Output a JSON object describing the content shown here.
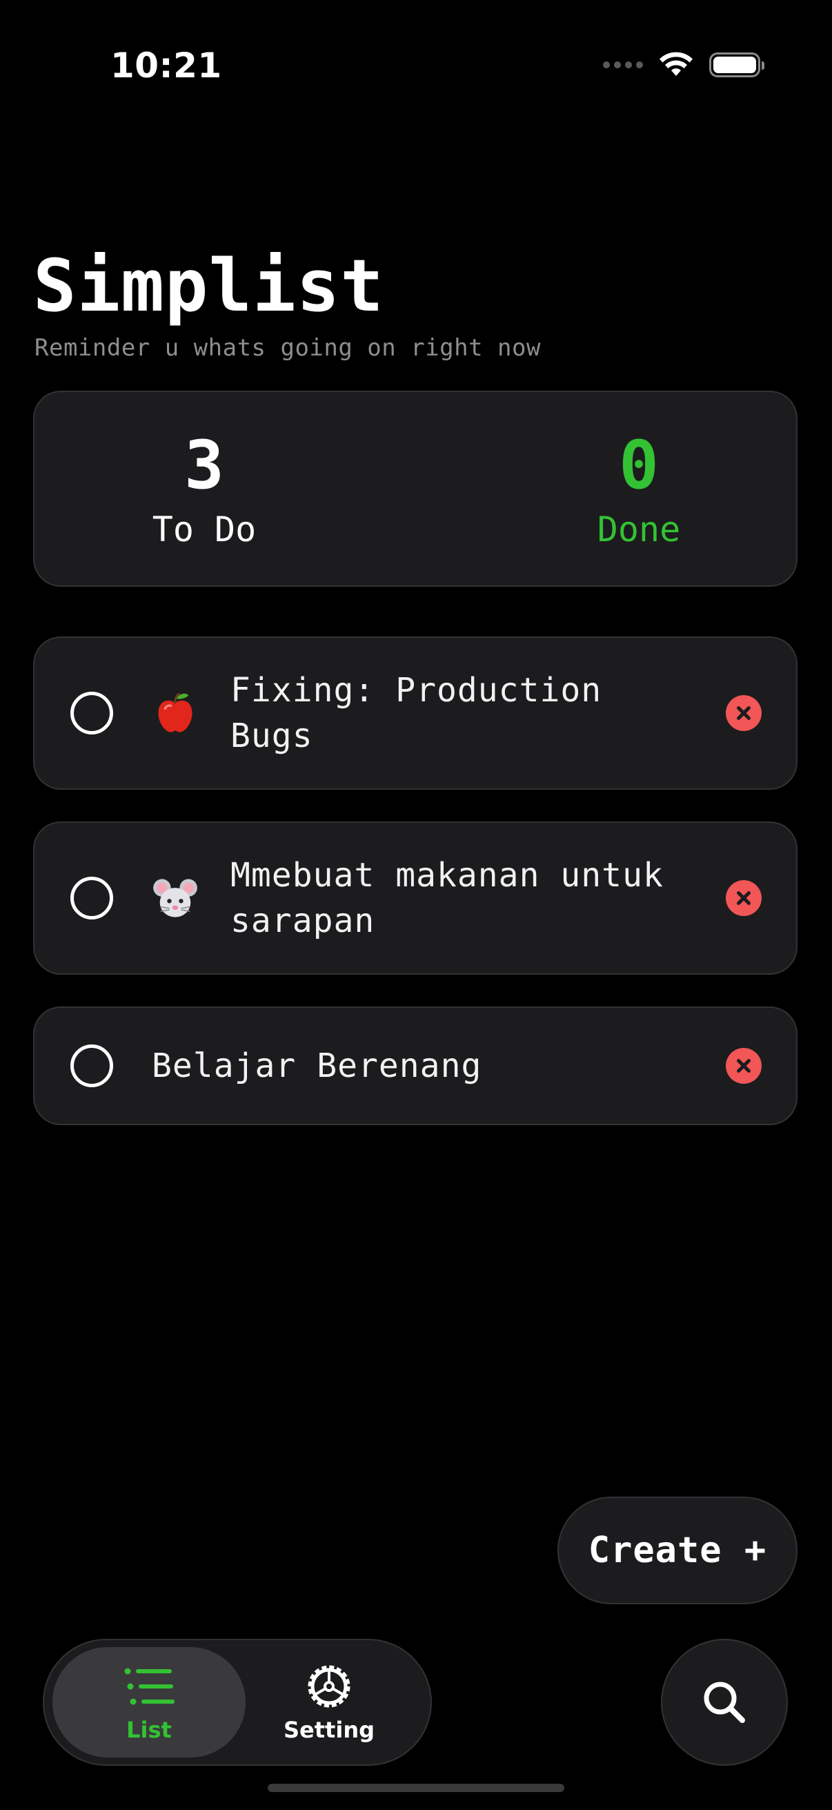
{
  "status_bar": {
    "time": "10:21"
  },
  "header": {
    "title": "Simplist",
    "subtitle": "Reminder u whats going on right now"
  },
  "stats": {
    "todo_count": "3",
    "todo_label": "To Do",
    "done_count": "0",
    "done_label": "Done",
    "done_color": "#33c233"
  },
  "tasks": [
    {
      "emoji": "apple-icon",
      "text": "Fixing: Production Bugs",
      "done": false
    },
    {
      "emoji": "mouse-face-icon",
      "text": "Mmebuat makanan untuk sarapan",
      "done": false
    },
    {
      "emoji": null,
      "text": "Belajar Berenang",
      "done": false
    }
  ],
  "create_button": {
    "label": "Create +"
  },
  "tab_bar": {
    "tabs": [
      {
        "label": "List",
        "icon": "list-icon",
        "active": true
      },
      {
        "label": "Setting",
        "icon": "gear-icon",
        "active": false
      }
    ],
    "search_icon": "search-icon"
  },
  "colors": {
    "accent": "#33c233",
    "danger": "#f25656",
    "card": "#1c1c1e"
  }
}
